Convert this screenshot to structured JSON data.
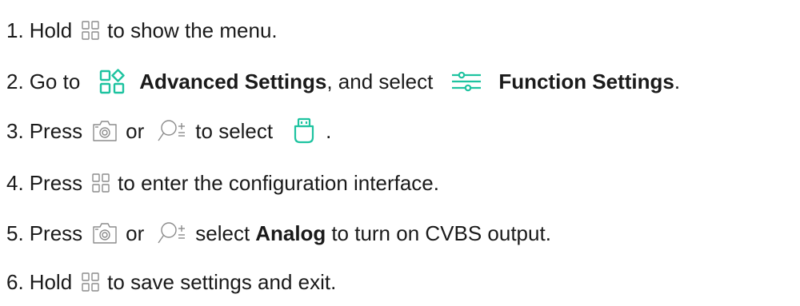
{
  "colors": {
    "text": "#1a1a1a",
    "icon_gray": "#8c8c8c",
    "accent_teal": "#1ec3a0"
  },
  "icons": {
    "menu": "menu-grid-icon",
    "advanced": "advanced-settings-icon",
    "function": "function-settings-sliders-icon",
    "capture": "capture-camera-icon",
    "zoom": "zoom-icon",
    "usb": "usb-output-icon"
  },
  "steps": [
    {
      "num": "1.",
      "before": "Hold",
      "after": "to show the menu."
    },
    {
      "num": "2.",
      "before": "Go to",
      "bold1": "Advanced Settings",
      "mid": ", and select",
      "bold2": "Function Settings",
      "end": "."
    },
    {
      "num": "3.",
      "before": "Press",
      "or": "or",
      "after": "to select",
      "end": "."
    },
    {
      "num": "4.",
      "before": "Press",
      "after": "to enter the configuration interface."
    },
    {
      "num": "5.",
      "before": "Press",
      "or": "or",
      "mid": "select",
      "bold": "Analog",
      "after": "to turn on CVBS output."
    },
    {
      "num": "6.",
      "before": "Hold",
      "after": "to save settings and exit."
    }
  ]
}
